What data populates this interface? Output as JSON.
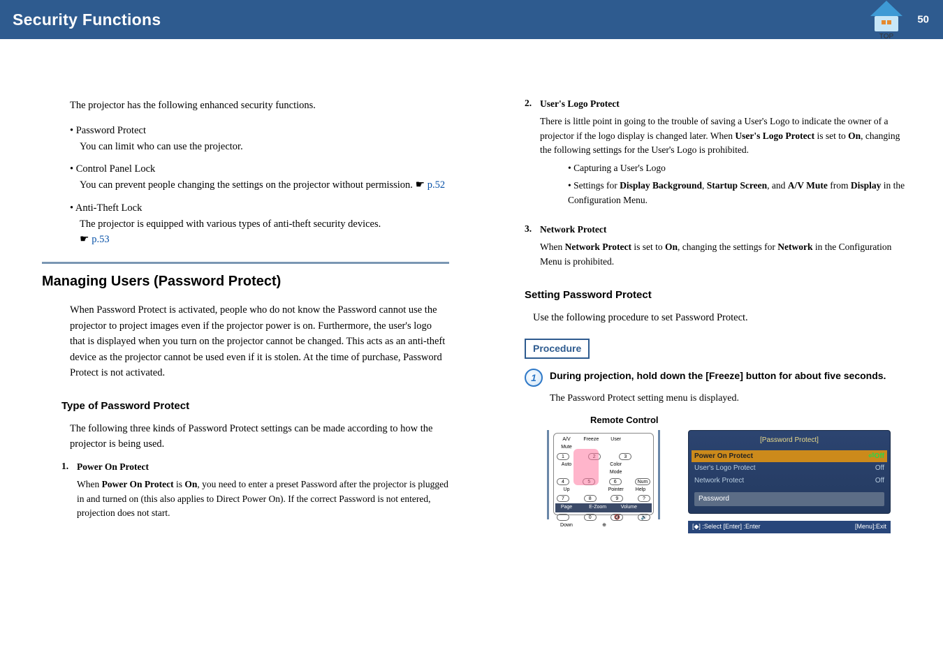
{
  "header": {
    "title": "Security Functions",
    "page_number": "50",
    "top_label": "TOP"
  },
  "left": {
    "intro": "The projector has the following enhanced security functions.",
    "bullets": [
      {
        "title": "Password Protect",
        "body": "You can limit who can use the projector."
      },
      {
        "title": "Control Panel Lock",
        "body": "You can prevent people changing the settings on the projector without permission.  ",
        "link": "p.52"
      },
      {
        "title": "Anti-Theft Lock",
        "body": "The projector is equipped with various types of anti-theft security devices.",
        "link": "p.53"
      }
    ],
    "section_title": "Managing Users (Password Protect)",
    "section_body": "When Password Protect is activated, people who do not know the Password cannot use the projector to project images even if the projector power is on. Furthermore, the user's logo that is displayed when you turn on the projector cannot be changed. This acts as an anti-theft device as the projector cannot be used even if it is stolen. At the time of purchase, Password Protect is not activated.",
    "sub_title": "Type of Password Protect",
    "sub_body": "The following three kinds of Password Protect settings can be made according to how the projector is being used.",
    "item1_num": "1.",
    "item1_title": "Power On Protect",
    "item1_body_a": "When ",
    "item1_body_b": "Power On Protect",
    "item1_body_c": " is ",
    "item1_body_d": "On",
    "item1_body_e": ", you need to enter a preset Password after the projector is plugged in and turned on (this also applies to Direct Power On). If the correct Password is not entered, projection does not start."
  },
  "right": {
    "item2_num": "2.",
    "item2_title": "User's Logo Protect",
    "item2_body_a": "There is little point in going to the trouble of saving a User's Logo to indicate the owner of a projector if the logo display is changed later. When ",
    "item2_body_b": "User's Logo Protect",
    "item2_body_c": " is set to ",
    "item2_body_d": "On",
    "item2_body_e": ", changing the following settings for the User's Logo is prohibited.",
    "item2_sub1": "Capturing a User's Logo",
    "item2_sub2_a": "Settings for ",
    "item2_sub2_b": "Display Background",
    "item2_sub2_c": ", ",
    "item2_sub2_d": "Startup Screen",
    "item2_sub2_e": ", and ",
    "item2_sub2_f": "A/V Mute",
    "item2_sub2_g": " from ",
    "item2_sub2_h": "Display",
    "item2_sub2_i": " in the Configuration Menu.",
    "item3_num": "3.",
    "item3_title": "Network Protect",
    "item3_body_a": "When ",
    "item3_body_b": "Network Protect",
    "item3_body_c": " is set to ",
    "item3_body_d": "On",
    "item3_body_e": ", changing the settings for ",
    "item3_body_f": "Network",
    "item3_body_g": " in the Configuration Menu is prohibited.",
    "sub2_title": "Setting Password Protect",
    "sub2_body": "Use the following procedure to set Password Protect.",
    "procedure_label": "Procedure",
    "step1_num": "1",
    "step1_text": "During projection, hold down the [Freeze] button for about five seconds.",
    "step1_body": "The Password Protect setting menu is displayed.",
    "remote_label": "Remote Control",
    "remote_labels": {
      "avmute": "A/V Mute",
      "freeze": "Freeze",
      "user": "User",
      "auto": "Auto",
      "colormode": "Color Mode",
      "num": "Num",
      "up": "Up",
      "pointer": "Pointer",
      "help": "Help",
      "page": "Page",
      "ezoom": "E-Zoom",
      "volume": "Volume",
      "down": "Down"
    },
    "menu": {
      "title": "[Password Protect]",
      "rows": [
        {
          "k": "Power On Protect",
          "v": "Off",
          "sel": true,
          "prefix": "⏎"
        },
        {
          "k": "User's Logo Protect",
          "v": "Off"
        },
        {
          "k": "Network Protect",
          "v": "Off"
        }
      ],
      "password_label": "Password",
      "footer_left": "[◆] :Select  [Enter] :Enter",
      "footer_right": "[Menu]:Exit"
    }
  }
}
